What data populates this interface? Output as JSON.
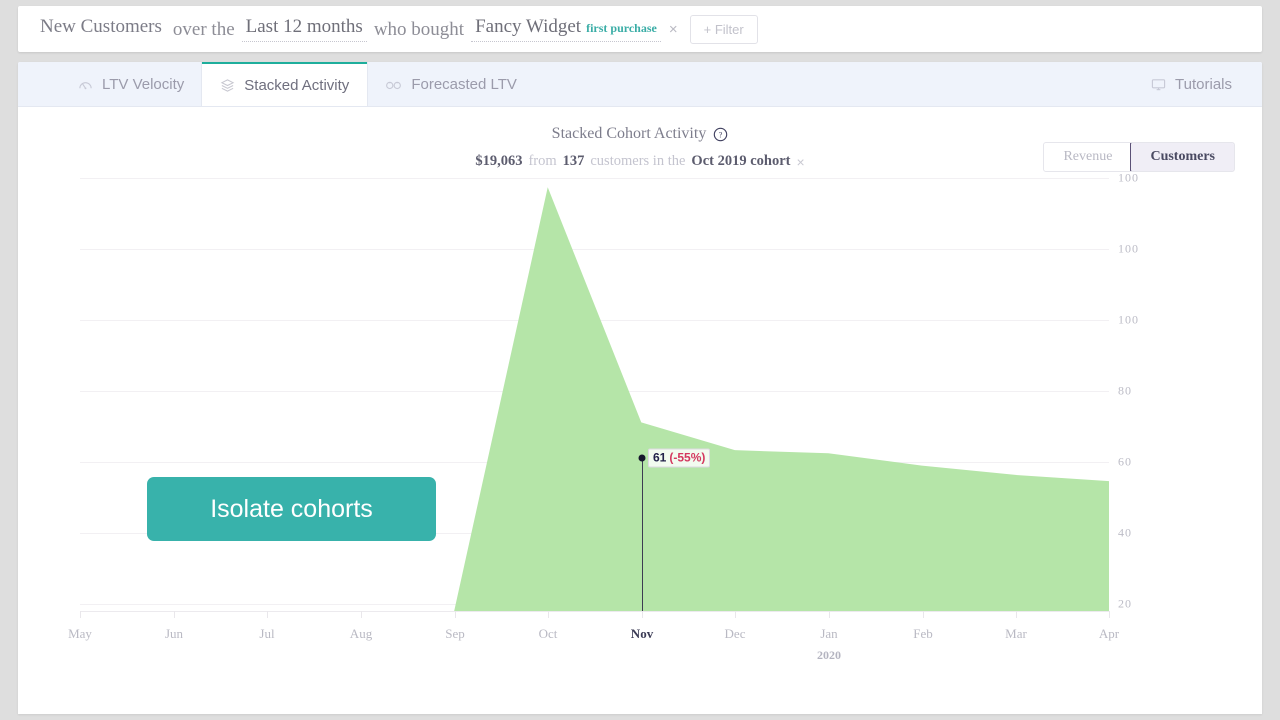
{
  "query": {
    "subject": "New Customers",
    "connector1": "over the",
    "period": "Last 12 months",
    "connector2": "who bought",
    "product": "Fancy Widget",
    "product_tag": "first purchase",
    "remove_label": "×",
    "filter_label": "+ Filter"
  },
  "tabs": [
    {
      "label": "LTV Velocity",
      "icon": "gauge-icon",
      "active": false
    },
    {
      "label": "Stacked Activity",
      "icon": "layers-icon",
      "active": true
    },
    {
      "label": "Forecasted LTV",
      "icon": "binocular-icon",
      "active": false
    }
  ],
  "tutorials": {
    "label": "Tutorials",
    "icon": "monitor-icon"
  },
  "chart_header": {
    "title": "Stacked Cohort Activity",
    "help_icon": "question-circle-icon",
    "revenue": "$19,063",
    "from": "from",
    "count": "137",
    "customers_in_the": "customers in the",
    "cohort": "Oct 2019 cohort",
    "close": "×"
  },
  "toggle": {
    "options": [
      "Revenue",
      "Customers"
    ],
    "selected": "Customers"
  },
  "callout": {
    "label": "Isolate cohorts"
  },
  "marker": {
    "value": "61",
    "change": "(-55%)",
    "month": "Nov"
  },
  "colors": {
    "accent_teal": "#38b2ab",
    "area_fill": "#b5e5a8",
    "tab_active_border": "#1eae9c",
    "toggle_active_bg": "#f0eef6",
    "negative_red": "#d4395f"
  },
  "chart_data": {
    "type": "area",
    "title": "Stacked Cohort Activity",
    "xlabel": "",
    "ylabel": "",
    "grid": true,
    "legend": "none",
    "categories": [
      "May",
      "Jun",
      "Jul",
      "Aug",
      "Sep",
      "Oct",
      "Nov",
      "Dec",
      "Jan",
      "Feb",
      "Mar",
      "Apr"
    ],
    "year_marks": [
      {
        "category": "Jan",
        "label": "2020"
      }
    ],
    "ytick_labels": [
      "100",
      "100",
      "100",
      "80",
      "60",
      "40",
      "20"
    ],
    "ytick_values": [
      140,
      120,
      100,
      80,
      60,
      40,
      20
    ],
    "ylim": [
      0,
      145
    ],
    "series": [
      {
        "name": "Oct 2019 cohort",
        "values": [
          0,
          0,
          0,
          0,
          0,
          137,
          61,
          52,
          51,
          47,
          44,
          42
        ]
      }
    ],
    "annotations": [
      {
        "category": "Nov",
        "value": 61,
        "label": "61",
        "change": "(-55%)",
        "highlighted": true
      }
    ],
    "summary": {
      "revenue": "$19,063",
      "customers": 137,
      "cohort": "Oct 2019 cohort"
    }
  }
}
